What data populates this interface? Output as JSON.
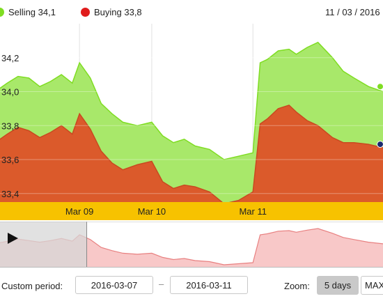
{
  "legend": {
    "selling_label": "Selling 34,1",
    "buying_label": "Buying 33,8",
    "date": "11 / 03 / 2016"
  },
  "colors": {
    "selling": "#7fdd22",
    "selling_fill": "#a8e86a",
    "buying": "#e01c1c",
    "buying_fill": "#db5a2b",
    "axis_band": "#f7c200",
    "navigator_line": "#e88080",
    "navigator_fill": "#f8c8c8"
  },
  "controls": {
    "custom_period_label": "Custom period:",
    "date_from": "2016-03-07",
    "date_separator": "–",
    "date_to": "2016-03-11",
    "zoom_label": "Zoom:",
    "zoom_5days": "5 days",
    "zoom_max": "MAX"
  },
  "chart_data": {
    "type": "area",
    "ylim": [
      33.35,
      34.4
    ],
    "yticks": [
      {
        "value": 33.4,
        "label": "33,4"
      },
      {
        "value": 33.6,
        "label": "33,6"
      },
      {
        "value": 33.8,
        "label": "33,8"
      },
      {
        "value": 34.0,
        "label": "34,0"
      },
      {
        "value": 34.2,
        "label": "34,2"
      }
    ],
    "xlim": [
      -0.1,
      5.2
    ],
    "xticks": [
      {
        "value": 1.0,
        "label": "Mar 09"
      },
      {
        "value": 2.0,
        "label": "Mar 10"
      },
      {
        "value": 3.4,
        "label": "Mar 11"
      }
    ],
    "grid": true,
    "series": [
      {
        "name": "Selling",
        "x": [
          -0.1,
          0.0,
          0.15,
          0.3,
          0.45,
          0.6,
          0.75,
          0.9,
          1.0,
          1.15,
          1.3,
          1.45,
          1.6,
          1.8,
          2.0,
          2.15,
          2.3,
          2.45,
          2.6,
          2.8,
          3.0,
          3.2,
          3.4,
          3.5,
          3.6,
          3.75,
          3.9,
          4.0,
          4.15,
          4.3,
          4.5,
          4.65,
          4.8,
          5.0,
          5.2
        ],
        "values": [
          34.02,
          34.05,
          34.09,
          34.08,
          34.03,
          34.06,
          34.1,
          34.05,
          34.17,
          34.08,
          33.93,
          33.87,
          33.82,
          33.8,
          33.82,
          33.74,
          33.7,
          33.72,
          33.68,
          33.66,
          33.6,
          33.62,
          33.64,
          34.17,
          34.19,
          34.24,
          34.25,
          34.22,
          34.26,
          34.29,
          34.2,
          34.12,
          34.08,
          34.03,
          34.0
        ]
      },
      {
        "name": "Buying",
        "x": [
          -0.1,
          0.0,
          0.15,
          0.3,
          0.45,
          0.6,
          0.75,
          0.9,
          1.0,
          1.15,
          1.3,
          1.45,
          1.6,
          1.8,
          2.0,
          2.15,
          2.3,
          2.45,
          2.6,
          2.8,
          3.0,
          3.2,
          3.4,
          3.5,
          3.6,
          3.75,
          3.9,
          4.0,
          4.15,
          4.3,
          4.5,
          4.65,
          4.8,
          5.0,
          5.2
        ],
        "values": [
          33.72,
          33.75,
          33.79,
          33.77,
          33.73,
          33.76,
          33.8,
          33.75,
          33.87,
          33.78,
          33.65,
          33.58,
          33.54,
          33.57,
          33.59,
          33.47,
          33.43,
          33.45,
          33.44,
          33.41,
          33.34,
          33.36,
          33.41,
          33.81,
          33.84,
          33.9,
          33.92,
          33.88,
          33.83,
          33.8,
          33.73,
          33.7,
          33.7,
          33.69,
          33.67
        ]
      }
    ]
  },
  "navigator": {
    "x": [
      -0.1,
      0.15,
      0.3,
      0.45,
      0.6,
      0.75,
      0.9,
      1.0,
      1.15,
      1.3,
      1.45,
      1.6,
      1.8,
      2.0,
      2.15,
      2.3,
      2.45,
      2.6,
      2.8,
      3.0,
      3.2,
      3.4,
      3.5,
      3.6,
      3.75,
      3.9,
      4.0,
      4.15,
      4.3,
      4.5,
      4.65,
      4.8,
      5.0,
      5.2
    ],
    "values": [
      34.02,
      34.09,
      34.06,
      34.03,
      34.06,
      34.1,
      34.05,
      34.17,
      34.08,
      33.93,
      33.87,
      33.82,
      33.8,
      33.82,
      33.74,
      33.7,
      33.72,
      33.68,
      33.66,
      33.6,
      33.62,
      33.64,
      34.17,
      34.19,
      34.24,
      34.25,
      34.22,
      34.26,
      34.29,
      34.2,
      34.12,
      34.08,
      34.03,
      34.0
    ],
    "selected_until": 1.1
  }
}
